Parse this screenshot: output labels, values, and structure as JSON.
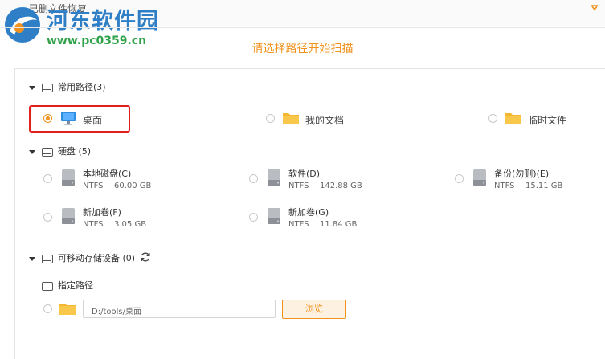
{
  "window": {
    "title": "已删文件恢复"
  },
  "watermark": {
    "site_name": "河东软件园",
    "url": "www.pc0359.cn"
  },
  "prompt": "请选择路径开始扫描",
  "common_paths": {
    "header": "常用路径",
    "count": "(3)",
    "items": [
      {
        "label": "桌面",
        "checked": true,
        "icon": "desktop-monitor-icon"
      },
      {
        "label": "我的文档",
        "checked": false,
        "icon": "folder-icon"
      },
      {
        "label": "临时文件",
        "checked": false,
        "icon": "folder-icon"
      }
    ]
  },
  "disks": {
    "header": "硬盘",
    "count": "(5)",
    "items": [
      {
        "name": "本地磁盘(C)",
        "fs": "NTFS",
        "size": "60.00 GB"
      },
      {
        "name": "软件(D)",
        "fs": "NTFS",
        "size": "142.88 GB"
      },
      {
        "name": "备份(勿删)(E)",
        "fs": "NTFS",
        "size": "15.11 GB"
      },
      {
        "name": "新加卷(F)",
        "fs": "NTFS",
        "size": "3.05 GB"
      },
      {
        "name": "新加卷(G)",
        "fs": "NTFS",
        "size": "11.84 GB"
      }
    ]
  },
  "removable": {
    "header": "可移动存储设备",
    "count": "(0)"
  },
  "custom_path": {
    "header": "指定路径",
    "value": "D:/tools/桌面",
    "browse_label": "浏览"
  },
  "colors": {
    "accent": "#f0921c",
    "highlight_border": "#e11f1f",
    "folder": "#f5b731",
    "monitor": "#2e8fe0"
  }
}
